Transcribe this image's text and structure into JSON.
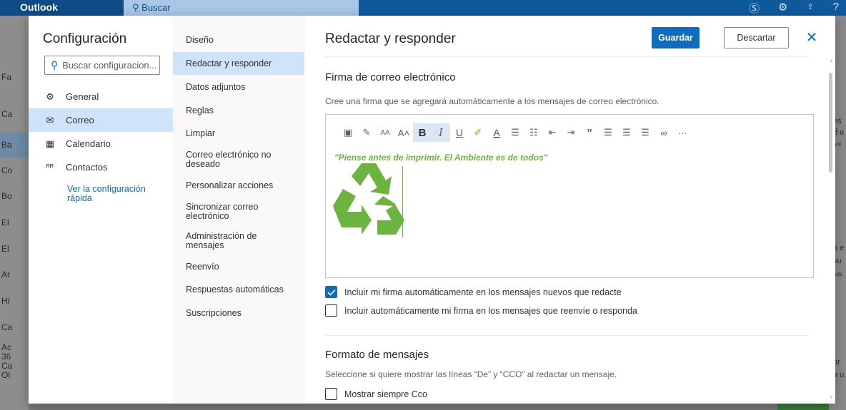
{
  "app": {
    "brand": "Outlook",
    "search": "Buscar"
  },
  "bg_left": [
    "Fa",
    "Ca",
    "Ba",
    "Co",
    "Bo",
    "El",
    "El",
    "Ar",
    "Hi",
    "Ca",
    "Ac",
    "36",
    "Ca",
    "Ol"
  ],
  "bg_right": [
    "es u",
    "o e",
    "ant",
    "a e",
    "su",
    "ads",
    "pr",
    "a u"
  ],
  "settings": {
    "title": "Configuración",
    "search_placeholder": "Buscar configuracion...",
    "nav": [
      {
        "label": "General",
        "icon": "gear-icon"
      },
      {
        "label": "Correo",
        "icon": "mail-icon",
        "active": true
      },
      {
        "label": "Calendario",
        "icon": "calendar-icon"
      },
      {
        "label": "Contactos",
        "icon": "people-icon"
      }
    ],
    "quick_link": "Ver la configuración rápida"
  },
  "subnav": [
    "Diseño",
    "Redactar y responder",
    "Datos adjuntos",
    "Reglas",
    "Limpiar",
    "Correo electrónico no deseado",
    "Personalizar acciones",
    "Sincronizar correo electrónico",
    "Administración de mensajes",
    "Reenvío",
    "Respuestas automáticas",
    "Suscripciones"
  ],
  "subnav_active": "Redactar y responder",
  "panel": {
    "title": "Redactar y responder",
    "save": "Guardar",
    "discard": "Descartar",
    "signature": {
      "heading": "Firma de correo electrónico",
      "description": "Cree una firma que se agregará automáticamente a los mensajes de correo electrónico.",
      "text": "\"Piense antes de imprimir. El Ambiente es de todos\""
    },
    "toolbar": [
      "image-icon",
      "format-painter-icon",
      "font-size-icon",
      "grow-font-icon",
      "bold-icon",
      "italic-icon",
      "underline-icon",
      "highlight-icon",
      "font-color-icon",
      "bullets-icon",
      "numbering-icon",
      "outdent-icon",
      "indent-icon",
      "quote-icon",
      "align-left-icon",
      "align-center-icon",
      "align-right-icon",
      "link-icon",
      "more-icon"
    ],
    "options": [
      {
        "label": "Incluir mi firma automáticamente en los mensajes nuevos que redacte",
        "checked": true
      },
      {
        "label": "Incluir automáticamente mi firma en los mensajes que reenvíe o responda",
        "checked": false
      }
    ],
    "format": {
      "heading": "Formato de mensajes",
      "description": "Seleccione si quiere mostrar las líneas “De” y “CCO” al redactar un mensaje.",
      "option": {
        "label": "Mostrar siempre Cco",
        "checked": false
      }
    }
  },
  "colors": {
    "accent": "#0f6cbd",
    "selected": "#cfe4fa",
    "signature_green": "#6db33f"
  }
}
